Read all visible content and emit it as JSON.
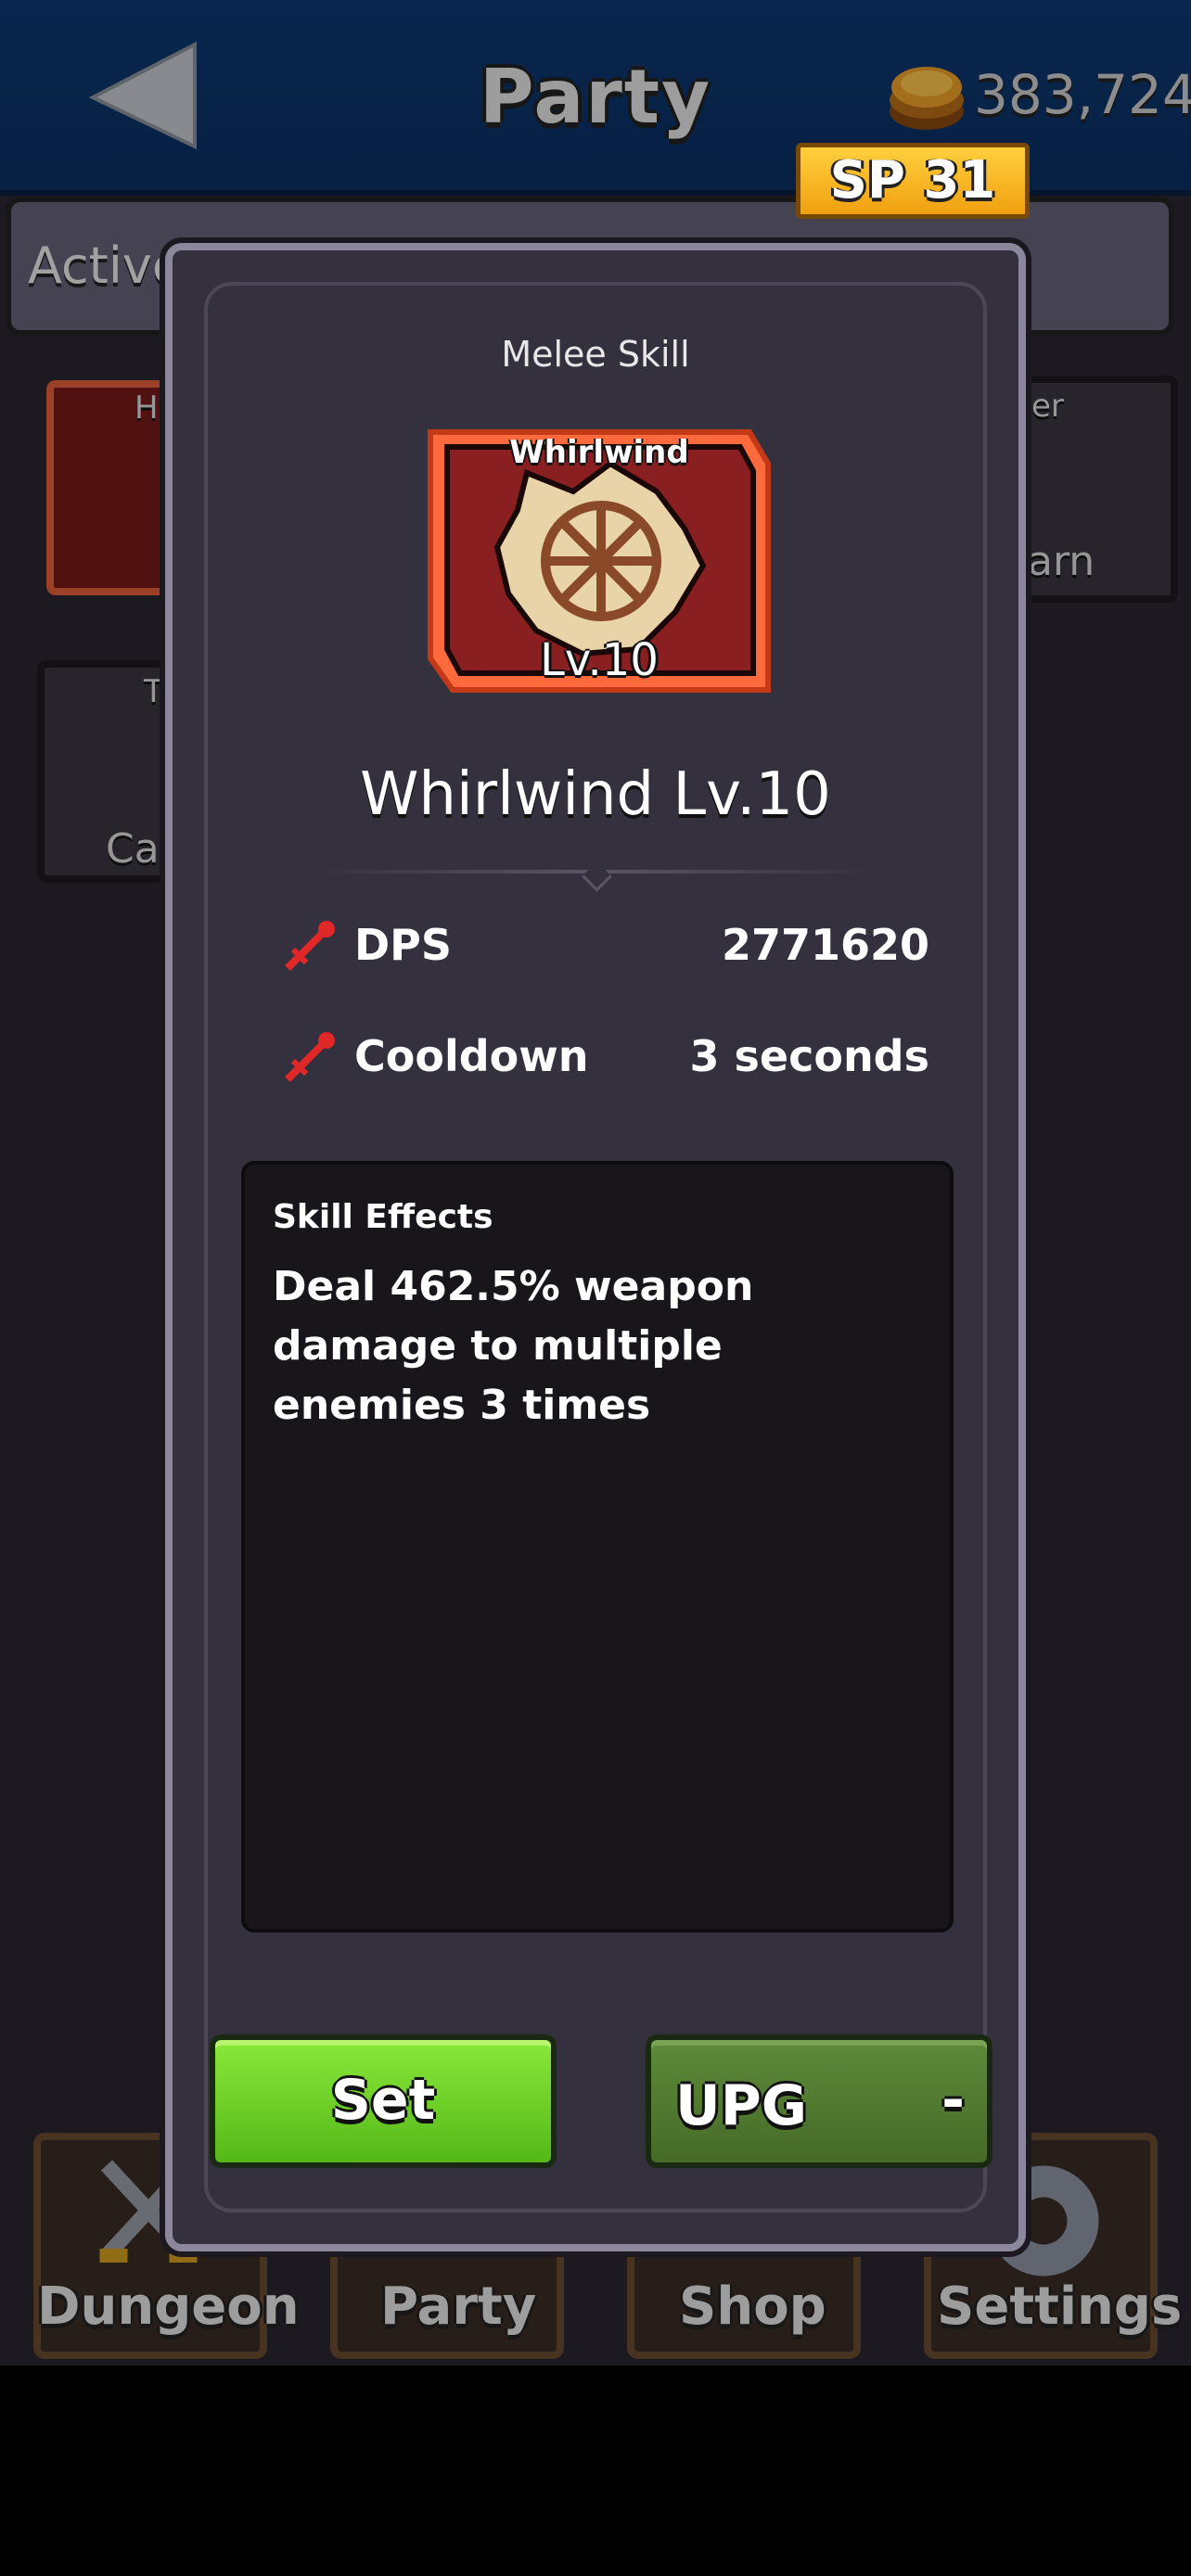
{
  "header": {
    "title": "Party",
    "gold_amount": "383,724",
    "sp_label": "SP 31"
  },
  "background": {
    "active_tab_label": "Active",
    "slot_left_top_letter": "H",
    "slot_left_mid_letter": "T",
    "slot_left_mid_text": "Ca",
    "slot_right_top_text": "er",
    "slot_right_bottom_text": "arn"
  },
  "bottom_nav": {
    "items": [
      {
        "label": "Dungeon"
      },
      {
        "label": "Party"
      },
      {
        "label": "Shop"
      },
      {
        "label": "Settings"
      }
    ]
  },
  "modal": {
    "category": "Melee Skill",
    "icon_name": "Whirlwind",
    "icon_level": "Lv.10",
    "title": "Whirlwind Lv.10",
    "stats": [
      {
        "label": "DPS",
        "value": "2771620",
        "icon": "sword-icon"
      },
      {
        "label": "Cooldown",
        "value": "3 seconds",
        "icon": "sword-icon"
      }
    ],
    "effects_title": "Skill Effects",
    "effects_text": "Deal 462.5% weapon damage to multiple enemies 3 times",
    "set_label": "Set",
    "upg_label": "UPG",
    "upg_cost": "-"
  },
  "colors": {
    "header_blue": "#0e3a74",
    "modal_bg": "#35303e",
    "set_green": "#6fd22a",
    "upg_green": "#527a31",
    "sp_gold": "#f5b41f",
    "skill_frame_orange": "#ff6a3d",
    "skill_icon_red": "#8a1f22"
  }
}
